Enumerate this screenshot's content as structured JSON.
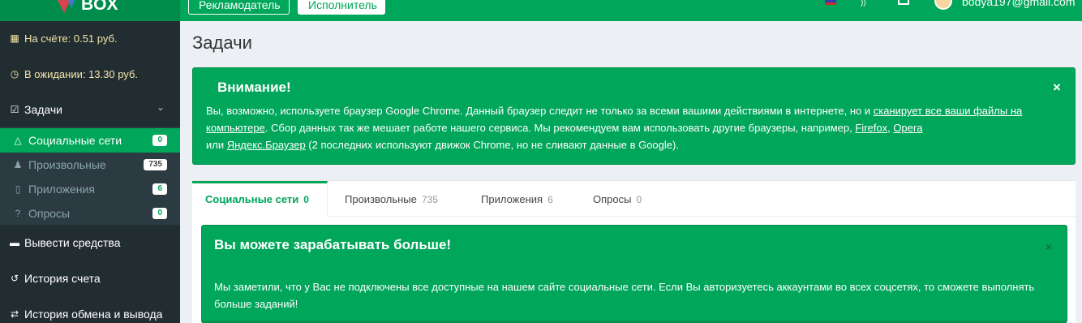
{
  "header": {
    "logo_text": "BOX",
    "advertiser_label": "Рекламодатель",
    "executor_label": "Исполнитель",
    "user_email": "bodya197@gmail.com"
  },
  "sidebar": {
    "balance": "На счёте: 0.51 руб.",
    "pending": "В ожидании: 13.30 руб.",
    "tasks": "Задачи",
    "sub_items": [
      {
        "label": "Социальные сети",
        "count": "0"
      },
      {
        "label": "Произвольные",
        "count": "735"
      },
      {
        "label": "Приложения",
        "count": "6"
      },
      {
        "label": "Опросы",
        "count": "0"
      }
    ],
    "withdraw": "Вывести средства",
    "history": "История счета",
    "exchange": "История обмена и вывода"
  },
  "main": {
    "title": "Задачи",
    "alert": {
      "title": "Внимание!",
      "close": "×",
      "text1": "Вы, возможно, используете браузер Google Chrome. Данный браузер следит не только за всеми вашими действиями в интернете, но и ",
      "link1": "сканирует все ваши файлы на компьютере",
      "text2": ". Сбор данных так же мешает работе нашего сервиса. Мы рекомендуем вам использовать другие браузеры, например, ",
      "link_firefox": "Firefox",
      "comma": ", ",
      "link_opera": "Opera",
      "text3": " или ",
      "link_yandex": "Яндекс.Браузер",
      "text4": " (2 последних используют движок Chrome, но не сливают данные в Google)."
    },
    "tabs": [
      {
        "label": "Социальные сети",
        "count": "0"
      },
      {
        "label": "Произвольные",
        "count": "735"
      },
      {
        "label": "Приложения",
        "count": "6"
      },
      {
        "label": "Опросы",
        "count": "0"
      }
    ],
    "earn_alert": {
      "title": "Вы можете зарабатывать больше!",
      "close": "×",
      "text": "Мы заметили, что у Вас не подключены все доступные на нашем сайте социальные сети. Если Вы авторизуетесь аккаунтами во всех соцсетях, то сможете выполнять больше заданий!"
    }
  },
  "colors": {
    "brand_green": "#00a65a",
    "sidebar_bg": "#222d32"
  }
}
